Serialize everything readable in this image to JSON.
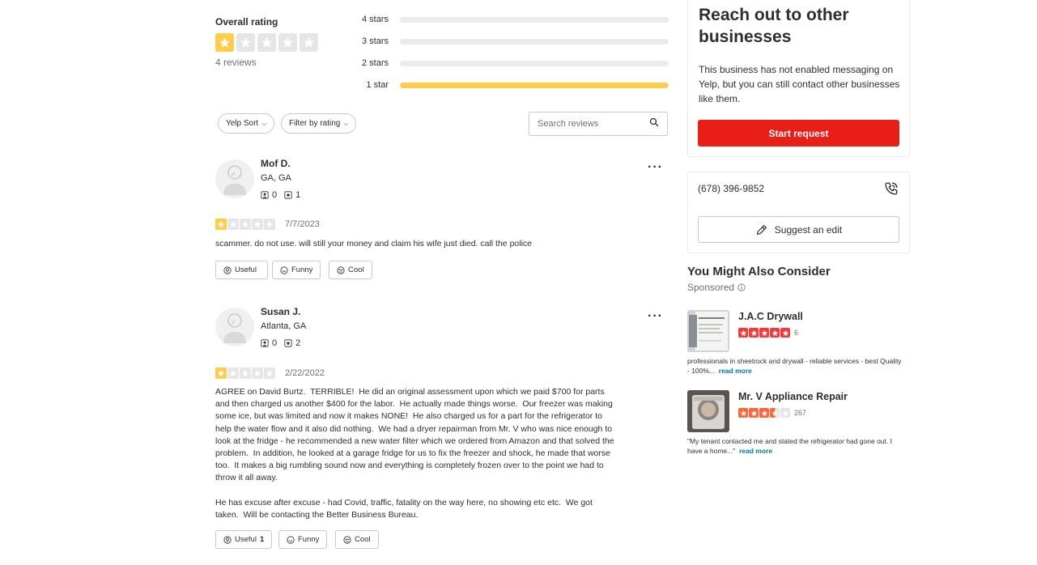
{
  "rating_summary": {
    "overall_label": "Overall rating",
    "rating": 1,
    "reviews_count": "4 reviews",
    "distribution": [
      {
        "label": "4 stars",
        "fraction": 0
      },
      {
        "label": "3 stars",
        "fraction": 0
      },
      {
        "label": "2 stars",
        "fraction": 0
      },
      {
        "label": "1 star",
        "fraction": 1
      }
    ]
  },
  "filters": {
    "sort_label": "Yelp Sort",
    "rating_filter_label": "Filter by rating",
    "search_placeholder": "Search reviews"
  },
  "reviews": [
    {
      "name": "Mof D.",
      "location": "GA, GA",
      "friends": "0",
      "reviews": "1",
      "rating": 1,
      "date": "7/7/2023",
      "text": "scammer. do not use. will still your money and claim his wife just died. call the police",
      "useful_label": "Useful",
      "useful_count": "",
      "funny_label": "Funny",
      "cool_label": "Cool"
    },
    {
      "name": "Susan J.",
      "location": "Atlanta, GA",
      "friends": "0",
      "reviews": "2",
      "rating": 1,
      "date": "2/22/2022",
      "text": "AGREE on David Burtz.  TERRIBLE!  He did an original assessment upon which we paid $700 for parts and then charged us another $400 for the labor.  He actually made things worse.  Our freezer was making some ice, but was limited and now it makes NONE!  He also charged us for a part for the refrigerator to help the water flow and it also did nothing.  We had a dryer repairman from Mr. V who was nice enough to look at the fridge - he recommended a new water filter which we ordered from Amazon and that solved the problem.  In addition, he looked at a garage fridge for us to fix the freezer and shock, he made that worse too.  It makes a big rumbling sound now and everything is completely frozen over to the point we had to throw it all away.\n\nHe has excuse after excuse - had Covid, traffic, fatality on the way here, no showing etc etc.  We got taken.  Will be contacting the Better Business Bureau.",
      "useful_label": "Useful",
      "useful_count": "1",
      "funny_label": "Funny",
      "cool_label": "Cool"
    }
  ],
  "sidebar": {
    "reach_title": "Reach out to other businesses",
    "reach_text": "This business has not enabled messaging on Yelp, but you can still contact other businesses like them.",
    "start_request_label": "Start request",
    "phone": "(678) 396-9852",
    "suggest_edit_label": "Suggest an edit",
    "consider_title": "You Might Also Consider",
    "sponsored_label": "Sponsored",
    "businesses": [
      {
        "name": "J.A.C Drywall",
        "rating": 5,
        "review_count": "6",
        "snippet": "professionals in sheetrock and drywall - reliable services - best Quality - 100%...",
        "read_more": "read more"
      },
      {
        "name": "Mr. V Appliance Repair",
        "rating": 3.5,
        "review_count": "267",
        "snippet": "\"My tenant contacted me and stated the refrigerator had gone out. I have a home...\"",
        "read_more": "read more"
      }
    ]
  },
  "colors": {
    "star_yellow": "#ffcc4b",
    "star_red": "#f43939",
    "star_orange": "#ff643d",
    "brand_red": "#e91e16",
    "link_teal": "#027a97"
  }
}
